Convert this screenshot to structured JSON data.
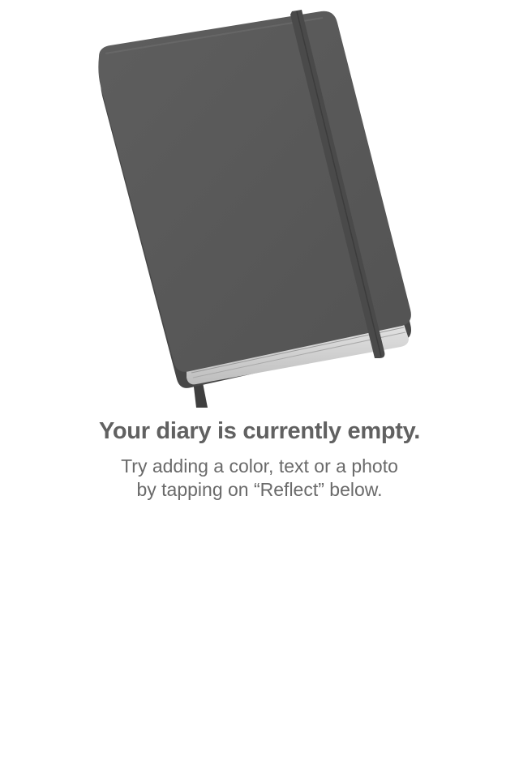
{
  "empty_state": {
    "illustration_icon": "notebook-icon",
    "title": "Your diary is currently empty.",
    "hint_line_1": "Try adding a color, text or a photo",
    "hint_line_2": "by tapping on “Reflect” below."
  },
  "colors": {
    "notebook_cover": "#595959",
    "notebook_strap": "#4a4a4a",
    "title_text": "#616161",
    "hint_text": "#6a6a6a",
    "background": "#ffffff"
  }
}
